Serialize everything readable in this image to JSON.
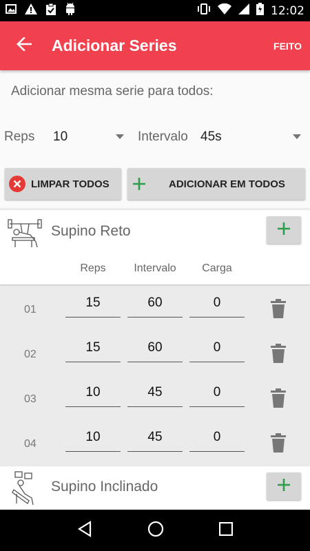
{
  "status": {
    "time": "12:02"
  },
  "app_bar": {
    "title": "Adicionar Series",
    "done_label": "FEITO"
  },
  "bulk": {
    "heading": "Adicionar mesma serie para todos:",
    "reps_label": "Reps",
    "reps_value": "10",
    "interval_label": "Intervalo",
    "interval_value": "45s",
    "clear_all_label": "LIMPAR TODOS",
    "add_all_label": "ADICIONAR EM TODOS"
  },
  "exercises": [
    {
      "name": "Supino Reto",
      "columns": [
        "Reps",
        "Intervalo",
        "Carga"
      ],
      "sets": [
        {
          "num": "01",
          "reps": "15",
          "interval": "60",
          "load": "0"
        },
        {
          "num": "02",
          "reps": "15",
          "interval": "60",
          "load": "0"
        },
        {
          "num": "03",
          "reps": "10",
          "interval": "45",
          "load": "0"
        },
        {
          "num": "04",
          "reps": "10",
          "interval": "45",
          "load": "0"
        }
      ]
    },
    {
      "name": "Supino Inclinado"
    }
  ],
  "colors": {
    "primary": "#f1414f",
    "accent_green": "#2e9d4a",
    "danger_red": "#e53935"
  }
}
